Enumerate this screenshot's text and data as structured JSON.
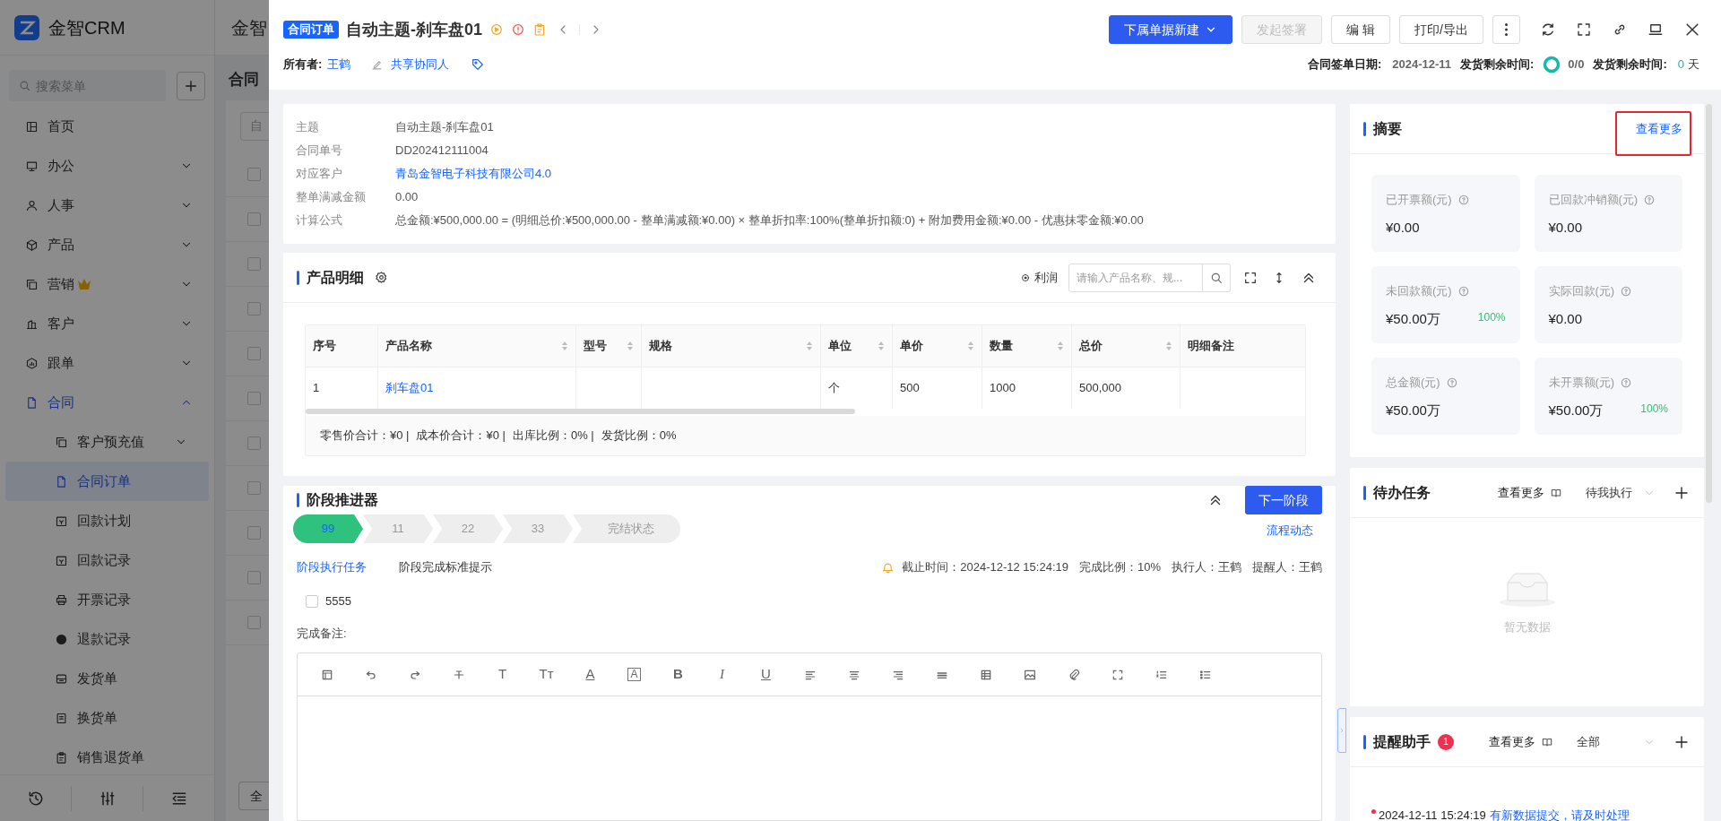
{
  "background_app": {
    "logo": "金智CRM",
    "top_title": "金智",
    "search_placeholder": "搜索菜单",
    "page_title": "合同",
    "filter": "自",
    "footer_button": "全",
    "rows": [
      {
        "checked": false
      },
      {
        "checked": false
      },
      {
        "checked": false
      },
      {
        "checked": false
      },
      {
        "checked": false
      },
      {
        "checked": false
      },
      {
        "checked": false
      },
      {
        "checked": false
      },
      {
        "checked": false
      },
      {
        "checked": false
      },
      {
        "checked": false
      }
    ]
  },
  "sidebar": {
    "items": [
      {
        "label": "首页",
        "selected": false
      },
      {
        "label": "办公",
        "expanded": false,
        "selected": false
      },
      {
        "label": "人事",
        "expanded": false,
        "selected": false
      },
      {
        "label": "产品",
        "expanded": false,
        "selected": false
      },
      {
        "label": "营销",
        "premium": true,
        "expanded": false,
        "selected": false
      },
      {
        "label": "客户",
        "expanded": false,
        "selected": false
      },
      {
        "label": "跟单",
        "expanded": false,
        "selected": false
      },
      {
        "label": "合同",
        "expanded": true,
        "selected": false,
        "active": true,
        "children": [
          {
            "label": "客户预充值",
            "expanded": false,
            "selected": false
          },
          {
            "label": "合同订单",
            "selected": true
          },
          {
            "label": "回款计划",
            "selected": false
          },
          {
            "label": "回款记录",
            "selected": false
          },
          {
            "label": "开票记录",
            "selected": false
          },
          {
            "label": "退款记录",
            "selected": false
          },
          {
            "label": "发货单",
            "selected": false
          },
          {
            "label": "换货单",
            "selected": false
          },
          {
            "label": "销售退货单",
            "selected": false
          }
        ]
      }
    ]
  },
  "drawer": {
    "badge": "合同订单",
    "title": "自动主题-刹车盘01",
    "buttons": [
      {
        "label": "下属单据新建",
        "kind": "dropdown",
        "disabled": false
      },
      {
        "label": "发起签署",
        "kind": "plain",
        "disabled": true
      },
      {
        "label": "编 辑",
        "kind": "plain",
        "disabled": false
      },
      {
        "label": "打印/导出",
        "kind": "plain",
        "disabled": false
      }
    ],
    "owner_label": "所有者:",
    "owner": "王鹤",
    "share": "共享协同人",
    "meta": [
      {
        "kind": "text",
        "label": "合同签单日期:",
        "value": "2024-12-11"
      },
      {
        "kind": "ring",
        "label": "发货剩余时间:",
        "value": "0/0"
      },
      {
        "kind": "days",
        "label": "发货剩余时间:",
        "value": "0",
        "unit": "天"
      }
    ]
  },
  "info": [
    {
      "label": "主题",
      "value": "自动主题-刹车盘01",
      "link": false
    },
    {
      "label": "合同单号",
      "value": "DD202412111004",
      "link": false
    },
    {
      "label": "对应客户",
      "value": "青岛金智电子科技有限公司4.0",
      "link": true
    },
    {
      "label": "整单满减金额",
      "value": "0.00",
      "link": false
    },
    {
      "label": "计算公式",
      "value": "总金额:¥500,000.00 = (明细总价:¥500,000.00 - 整单满减额:¥0.00) × 整单折扣率:100%(整单折扣额:0) + 附加费用金额:¥0.00 - 优惠抹零金额:¥0.00",
      "link": false
    }
  ],
  "products": {
    "title": "产品明细",
    "profit_label": "利润",
    "search_placeholder": "请输入产品名称、规...",
    "columns": [
      {
        "label": "序号",
        "sortable": false
      },
      {
        "label": "产品名称",
        "sortable": true
      },
      {
        "label": "型号",
        "sortable": true
      },
      {
        "label": "规格",
        "sortable": true
      },
      {
        "label": "单位",
        "sortable": true
      },
      {
        "label": "单价",
        "sortable": true
      },
      {
        "label": "数量",
        "sortable": true
      },
      {
        "label": "总价",
        "sortable": true
      },
      {
        "label": "明细备注",
        "sortable": false
      }
    ],
    "rows": [
      {
        "number": "1",
        "product": "刹车盘01",
        "unit": "个",
        "unit_price": "500",
        "quantity": "1000",
        "total": "500,000"
      }
    ],
    "summary": [
      "零售价合计：¥0 |",
      "成本价合计：¥0 |",
      "出库比例：0% |",
      "发货比例：0%"
    ]
  },
  "stage": {
    "title": "阶段推进器",
    "next_button": "下一阶段",
    "flow_link": "流程动态",
    "stages": [
      {
        "label": "99",
        "selected": true
      },
      {
        "label": "11",
        "selected": false
      },
      {
        "label": "22",
        "selected": false
      },
      {
        "label": "33",
        "selected": false
      },
      {
        "label": "完结状态",
        "selected": false
      }
    ],
    "tabs": [
      {
        "label": "阶段执行任务",
        "selected": true
      },
      {
        "label": "阶段完成标准提示",
        "selected": false
      }
    ],
    "details": [
      "截止时间：2024-12-12 15:24:19",
      "完成比例：10%",
      "执行人：王鹤",
      "提醒人：王鹤"
    ],
    "tasks": [
      {
        "label": "5555",
        "checked": false
      }
    ],
    "remark_label": "完成备注:",
    "toolbar": [
      {
        "kind": "layout"
      },
      {
        "kind": "undo"
      },
      {
        "kind": "redo"
      },
      {
        "kind": "strike"
      },
      {
        "kind": "text",
        "text": "T"
      },
      {
        "kind": "text-size",
        "text": "Tт"
      },
      {
        "kind": "font-color",
        "text": "A"
      },
      {
        "kind": "background-color",
        "text": "A"
      },
      {
        "kind": "bold",
        "text": "B"
      },
      {
        "kind": "italic",
        "text": "I"
      },
      {
        "kind": "underline",
        "text": "U"
      },
      {
        "kind": "align-left"
      },
      {
        "kind": "align-center"
      },
      {
        "kind": "align-right"
      },
      {
        "kind": "rule"
      },
      {
        "kind": "table"
      },
      {
        "kind": "image"
      },
      {
        "kind": "attach"
      },
      {
        "kind": "fullscreen"
      },
      {
        "kind": "ordered-list"
      },
      {
        "kind": "bullet-list"
      }
    ]
  },
  "summary": {
    "title": "摘要",
    "more": "查看更多",
    "highlighted": true,
    "stats": [
      {
        "label": "已开票额(元)",
        "value": "¥0.00"
      },
      {
        "label": "已回款冲销额(元)",
        "value": "¥0.00"
      },
      {
        "label": "未回款额(元)",
        "value": "¥50.00万",
        "percent": "100%"
      },
      {
        "label": "实际回款(元)",
        "value": "¥0.00"
      },
      {
        "label": "总金额(元)",
        "value": "¥50.00万"
      },
      {
        "label": "未开票额(元)",
        "value": "¥50.00万",
        "percent": "100%"
      }
    ]
  },
  "todo": {
    "title": "待办任务",
    "more": "查看更多",
    "filter": "待我执行",
    "empty": "暂无数据"
  },
  "reminders": {
    "title": "提醒助手",
    "badge": "1",
    "more": "查看更多",
    "filter": "全部",
    "items": [
      {
        "time": "2024-12-11 15:24:19",
        "text": "有新数据提交，请及时处理"
      }
    ]
  }
}
